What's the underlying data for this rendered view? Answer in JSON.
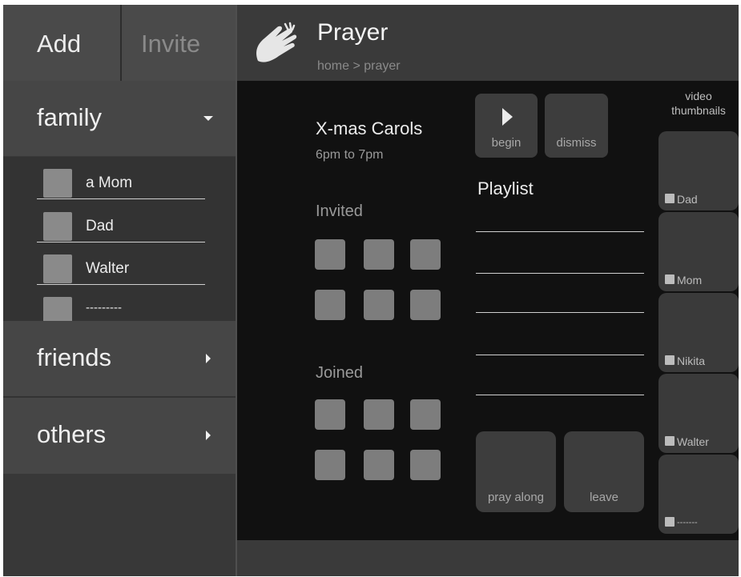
{
  "sidebar": {
    "tabs": {
      "add": "Add",
      "invite": "Invite"
    },
    "sections": [
      {
        "label": "family",
        "expanded": true
      },
      {
        "label": "friends",
        "expanded": false
      },
      {
        "label": "others",
        "expanded": false
      }
    ],
    "family_members": [
      "a Mom",
      "Dad",
      "Walter",
      "---------"
    ]
  },
  "header": {
    "icon": "praying-hands-icon",
    "title": "Prayer",
    "breadcrumb": "home > prayer"
  },
  "event": {
    "title": "X-mas Carols",
    "time": "6pm to 7pm",
    "invited_label": "Invited",
    "joined_label": "Joined"
  },
  "controls": {
    "begin": "begin",
    "dismiss": "dismiss",
    "pray_along": "pray along",
    "leave": "leave"
  },
  "playlist": {
    "label": "Playlist"
  },
  "video_thumbnails": {
    "label": "video\nthumbnails",
    "people": [
      "Dad",
      "Mom",
      "Nikita",
      "Walter",
      "-------"
    ]
  },
  "colors": {
    "frame": "#333333",
    "sidebar_header": "#4a4a4a",
    "content_bg": "#111111",
    "slot": "#7d7d7d"
  }
}
